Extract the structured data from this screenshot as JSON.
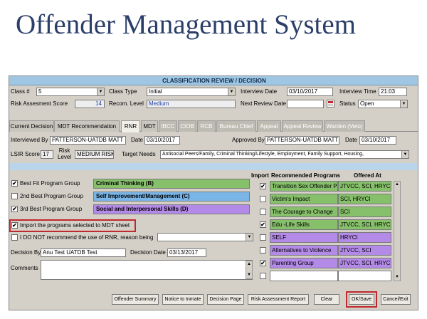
{
  "slide_title": "Offender Management System",
  "header": "CLASSIFICATION REVIEW / DECISION",
  "form": {
    "class_num_label": "Class #",
    "class_num": "5",
    "class_type_label": "Class Type",
    "class_type": "Initial",
    "interview_date_label": "Interview Date",
    "interview_date": "03/10/2017",
    "interview_time_label": "Interview Time",
    "interview_time": "21:03",
    "risk_score_label": "Risk Assesment Score",
    "risk_score": "14",
    "recom_level_label": "Recom. Level",
    "recom_level": "Medium",
    "next_review_label": "Next Review Date",
    "next_review": "",
    "status_label": "Status",
    "status": "Open"
  },
  "tabs": [
    {
      "label": "Current Decision",
      "state": "normal"
    },
    {
      "label": "MDT Recommendation",
      "state": "normal"
    },
    {
      "label": "RNR",
      "state": "active"
    },
    {
      "label": "MDT",
      "state": "normal"
    },
    {
      "label": "IBCC",
      "state": "disabled"
    },
    {
      "label": "CIOB",
      "state": "disabled"
    },
    {
      "label": "RCB",
      "state": "disabled"
    },
    {
      "label": "Bureau Chief",
      "state": "disabled"
    },
    {
      "label": "Appeal",
      "state": "disabled"
    },
    {
      "label": "Appeal Review",
      "state": "disabled"
    },
    {
      "label": "Warden (Veto)",
      "state": "disabled"
    }
  ],
  "rnr": {
    "interviewed_by_label": "Interviewed By",
    "interviewed_by": "PATTERSON-UATDB MATT",
    "date_label": "Date",
    "interview_date": "03/10/2017",
    "approved_by_label": "Approved By",
    "approved_by": "PATTERSON-UATDB MATT",
    "approved_date": "03/10/2017",
    "lsir_label": "LSIR Score",
    "lsir_score": "17",
    "risk_level_label_1": "Risk",
    "risk_level_label_2": "Level",
    "risk_level": "MEDIUM RISK",
    "target_needs_label": "Target Needs",
    "target_needs": "Antisocial Peers/Family, Criminal Thinking/Lifestyle, Employment, Family Support, Housing,"
  },
  "programs": {
    "best_fit_label": "Best Fit Program Group",
    "best_fit_checked": "✔",
    "best_fit_value": "Criminal Thinking (B)",
    "second_label": "2nd Best Program Group",
    "second_checked": "",
    "second_value": "Self Improvement/Management (C)",
    "third_label": "3rd Best Program Group",
    "third_checked": "✔",
    "third_value": "Social and Interpersonal Skills (D)",
    "import_label": "Import the programs selected to MDT sheet",
    "import_checked": "✔",
    "donot_label": "I DO NOT  recommend the use of RNR, reason being",
    "donot_checked": "",
    "decision_by_label": "Decision By",
    "decision_by": "Anu Test UATDB Test",
    "decision_date_label": "Decision Date",
    "decision_date": "03/13/2017",
    "comments_label": "Comments",
    "comments": ""
  },
  "recommended": {
    "col_import": "Import",
    "col_program": "Recommended Programs",
    "col_offered": "Offered At",
    "rows": [
      {
        "checked": "✔",
        "program": "Transition Sex Offender Pr",
        "offered": "JTVCC, SCI, HRYCI",
        "color": "green"
      },
      {
        "checked": "",
        "program": "Victim's Impact",
        "offered": "SCI, HRYCI",
        "color": "green"
      },
      {
        "checked": "",
        "program": "The Courage to Change",
        "offered": "SCI",
        "color": "green"
      },
      {
        "checked": "✔",
        "program": "Edu -Life Skills",
        "offered": "JTVCC, SCI, HRYCI",
        "color": "green"
      },
      {
        "checked": "",
        "program": "SELF",
        "offered": "HRYCI",
        "color": "purple"
      },
      {
        "checked": "",
        "program": "Alternatives to Violence",
        "offered": "JTVCC, SCI",
        "color": "purple"
      },
      {
        "checked": "✔",
        "program": "Parenting Group",
        "offered": "JTVCC, SCI, HRYCI",
        "color": "purple"
      },
      {
        "checked": "",
        "program": "",
        "offered": "",
        "color": "empty"
      }
    ]
  },
  "buttons": {
    "offender_summary": "Offender Summary",
    "notice_to_inmate": "Notice to Inmate",
    "decision_page": "Decision Page",
    "risk_report": "Risk Assessment Report",
    "clear": "Clear",
    "ok_save": "OK/Save",
    "cancel_exit": "Cancel/Exit"
  },
  "colors": {
    "green": "#86c06a",
    "blue": "#7ab5e8",
    "purple": "#b48ae8",
    "highlight": "#c0282d"
  }
}
